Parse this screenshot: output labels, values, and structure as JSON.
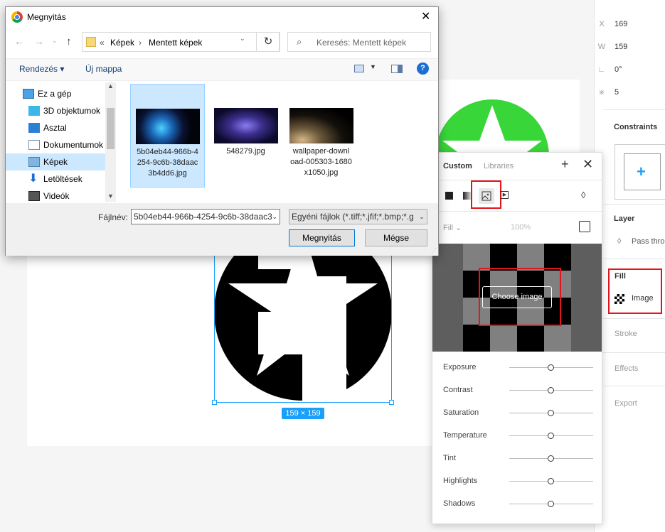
{
  "dialog": {
    "title": "Megnyitás",
    "breadcrumb": [
      "«",
      "Képek",
      "›",
      "Mentett képek"
    ],
    "search_placeholder": "Keresés: Mentett képek",
    "toolbar": {
      "organize": "Rendezés ▾",
      "new_folder": "Új mappa"
    },
    "sidebar": [
      {
        "label": "Ez a gép",
        "icon": "computer-icon"
      },
      {
        "label": "3D objektumok",
        "icon": "cube-icon"
      },
      {
        "label": "Asztal",
        "icon": "desktop-icon"
      },
      {
        "label": "Dokumentumok",
        "icon": "document-icon"
      },
      {
        "label": "Képek",
        "icon": "pictures-icon"
      },
      {
        "label": "Letöltések",
        "icon": "download-icon"
      },
      {
        "label": "Videók",
        "icon": "video-icon"
      }
    ],
    "files": [
      {
        "name": "5b04eb44-966b-4254-9c6b-38daac3b4dd6.jpg",
        "lines": [
          "5b04eb44-966b-4",
          "254-9c6b-38daac",
          "3b4dd6.jpg"
        ]
      },
      {
        "name": "548279.jpg",
        "lines": [
          "548279.jpg"
        ]
      },
      {
        "name": "wallpaper-download-005303-1680x1050.jpg",
        "lines": [
          "wallpaper-downl",
          "oad-005303-1680",
          "x1050.jpg"
        ]
      }
    ],
    "filename_label": "Fájlnév:",
    "filename_value": "5b04eb44-966b-4254-9c6b-38daac3",
    "filetype_value": "Egyéni fájlok (*.tiff;*.jfif;*.bmp;*.g",
    "open_button": "Megnyitás",
    "cancel_button": "Mégse"
  },
  "canvas": {
    "size_badge": "159 × 159"
  },
  "fill_panel": {
    "tabs": [
      "Custom",
      "Libraries"
    ],
    "fill_mode": "Fill",
    "opacity": "100%",
    "choose_image": "Choose image",
    "adjustments": [
      "Exposure",
      "Contrast",
      "Saturation",
      "Temperature",
      "Tint",
      "Highlights",
      "Shadows"
    ],
    "adjustment_values": [
      0,
      0,
      0,
      0,
      0,
      0,
      0
    ]
  },
  "right_panel": {
    "x_label": "X",
    "x_value": "169",
    "w_label": "W",
    "w_value": "159",
    "rotation_value": "0°",
    "corner_value": "5",
    "constraints": "Constraints",
    "layer": "Layer",
    "pass_through": "Pass thro",
    "fill": "Fill",
    "fill_type": "Image",
    "stroke": "Stroke",
    "effects": "Effects",
    "export": "Export"
  },
  "colors": {
    "accent": "#18a0fb",
    "highlight": "#e3141b",
    "green": "#39d63a"
  }
}
